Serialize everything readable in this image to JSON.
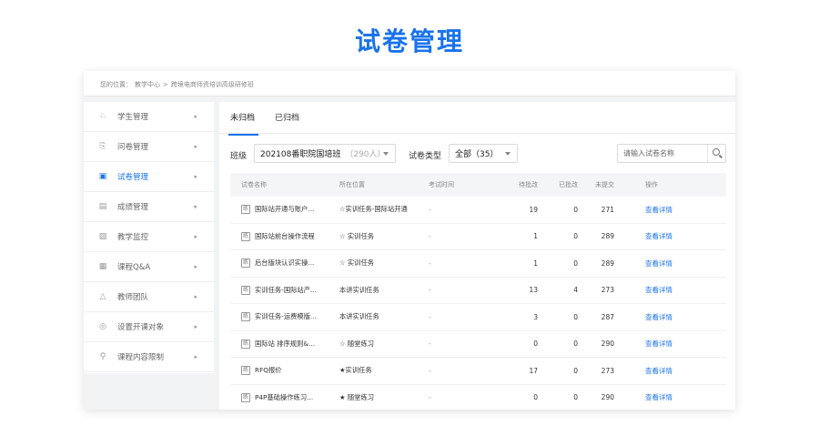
{
  "page_title": "试卷管理",
  "breadcrumb": [
    "您的位置：",
    "教学中心",
    ">",
    "跨境电商师资培训高级研修班"
  ],
  "sidebar": {
    "items": [
      {
        "label": "学生管理",
        "icon": "user-icon",
        "glyph": "♘",
        "active": false
      },
      {
        "label": "问卷管理",
        "icon": "survey-icon",
        "glyph": "⎘",
        "active": false
      },
      {
        "label": "试卷管理",
        "icon": "paper-icon",
        "glyph": "▣",
        "active": true
      },
      {
        "label": "成绩管理",
        "icon": "grade-icon",
        "glyph": "▤",
        "active": false
      },
      {
        "label": "教学监控",
        "icon": "monitor-icon",
        "glyph": "▨",
        "active": false
      },
      {
        "label": "课程Q&A",
        "icon": "qa-icon",
        "glyph": "▦",
        "active": false
      },
      {
        "label": "教师团队",
        "icon": "team-icon",
        "glyph": "△",
        "active": false
      },
      {
        "label": "设置开课对象",
        "icon": "target-icon",
        "glyph": "◎",
        "active": false
      },
      {
        "label": "课程内容限制",
        "icon": "limit-icon",
        "glyph": "⚲",
        "active": false
      }
    ],
    "chevron": "▸"
  },
  "tabs": [
    {
      "label": "未归档",
      "active": true
    },
    {
      "label": "已归档",
      "active": false
    }
  ],
  "filters": {
    "class_label": "班级",
    "class_value": "202108番职院国培班",
    "class_count": "（290人）",
    "type_label": "试卷类型",
    "type_value": "全部（35）",
    "search_placeholder": "请输入试卷名称"
  },
  "table": {
    "headers": {
      "name": "试卷名称",
      "location": "所在位置",
      "time": "考试时间",
      "pending": "待批改",
      "graded": "已批改",
      "unsubmitted": "未提交",
      "action": "操作"
    },
    "tag": "练",
    "action_label": "查看详情",
    "rows": [
      {
        "name": "国际站开通与账户...",
        "location": "☆实训任务-国际站开通",
        "time": "-",
        "pending": "19",
        "graded": "0",
        "unsubmitted": "271"
      },
      {
        "name": "国际站前台操作流程",
        "location": "☆ 实训任务",
        "time": "-",
        "pending": "1",
        "graded": "0",
        "unsubmitted": "289"
      },
      {
        "name": "后台版块认识实操...",
        "location": "☆ 实训任务",
        "time": "-",
        "pending": "1",
        "graded": "0",
        "unsubmitted": "289"
      },
      {
        "name": "实训任务-国际站产...",
        "location": "本讲实训任务",
        "time": "-",
        "pending": "13",
        "graded": "4",
        "unsubmitted": "273"
      },
      {
        "name": "实训任务-运费模版...",
        "location": "本讲实训任务",
        "time": "-",
        "pending": "3",
        "graded": "0",
        "unsubmitted": "287"
      },
      {
        "name": "国际站 排序规则&...",
        "location": "☆ 随堂练习",
        "time": "-",
        "pending": "0",
        "graded": "0",
        "unsubmitted": "290"
      },
      {
        "name": "RFQ报价",
        "location": "★实训任务",
        "time": "-",
        "pending": "17",
        "graded": "0",
        "unsubmitted": "273"
      },
      {
        "name": "P4P基础操作练习...",
        "location": "★ 随堂练习",
        "time": "-",
        "pending": "0",
        "graded": "0",
        "unsubmitted": "290"
      }
    ]
  },
  "colors": {
    "accent": "#1a73e8"
  }
}
